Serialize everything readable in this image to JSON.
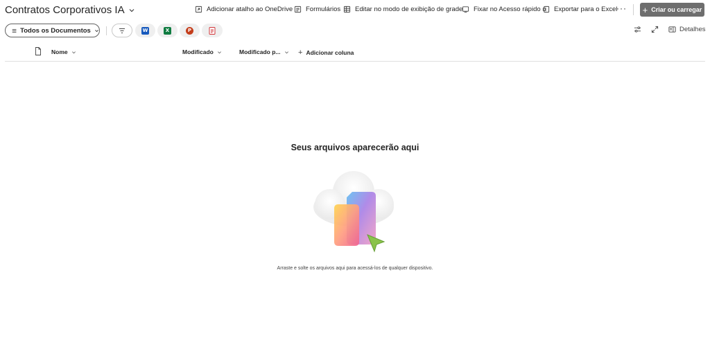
{
  "library": {
    "title": "Contratos Corporativos IA"
  },
  "commands": {
    "add_shortcut": "Adicionar atalho ao OneDrive",
    "forms": "Formulários",
    "grid_edit": "Editar no modo de exibição de grade",
    "pin_quick": "Fixar no Acesso rápido",
    "export_excel": "Exportar para o Excel",
    "more": "···",
    "create": "Criar ou carregar"
  },
  "filters": {
    "view": "Todos os Documentos",
    "chips": [
      {
        "icon": "filter-icon"
      },
      {
        "icon": "word-icon",
        "letter": "W",
        "color": "#185abd"
      },
      {
        "icon": "excel-icon",
        "letter": "X",
        "color": "#107c41"
      },
      {
        "icon": "powerpoint-icon",
        "letter": "P",
        "color": "#c43e1c"
      },
      {
        "icon": "pdf-icon",
        "color": "#d13438"
      }
    ]
  },
  "tools": {
    "details": "Detalhes"
  },
  "columns": {
    "name": "Nome",
    "modified": "Modificado",
    "modified_by": "Modificado p...",
    "add_column": "Adicionar coluna"
  },
  "empty_state": {
    "title": "Seus arquivos aparecerão aqui",
    "subtitle": "Arraste e solte os arquivos aqui para acessá-los de qualquer dispositivo."
  },
  "colors": {
    "primary_button": "#6e6e6e",
    "text": "#242424",
    "divider": "#e0e0e0"
  }
}
